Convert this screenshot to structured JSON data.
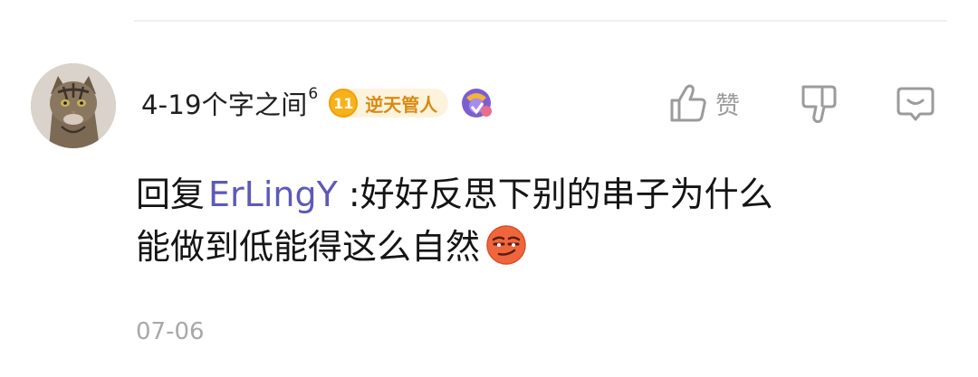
{
  "comment": {
    "username": "4-19个字之间",
    "username_superscript": "6",
    "level": "11",
    "level_title": "逆天管人",
    "actions": {
      "like_label": "赞",
      "like_icon": "thumbs-up-icon",
      "dislike_icon": "thumbs-down-icon",
      "reply_icon": "comment-bubble-icon"
    },
    "reply_prefix": "回复",
    "reply_to": "ErLingY",
    "line1": " :好好反思下别的串子为什么",
    "line2": "能做到低能得这么自然",
    "emoji": "smirk-face-emoji",
    "date": "07-06"
  },
  "colors": {
    "mention": "#5c5ab8",
    "level_badge": "#f7b21a",
    "level_text": "#d98a12",
    "secondary_text": "#a8a8a8"
  }
}
